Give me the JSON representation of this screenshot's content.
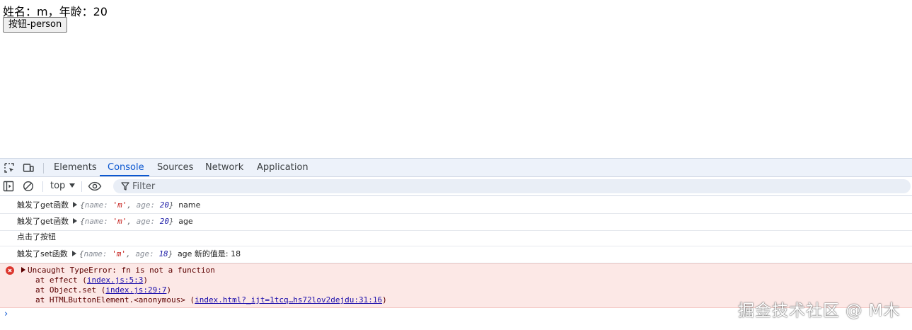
{
  "page": {
    "info_text": "姓名：m，年龄：20",
    "button_label": "按钮-person"
  },
  "devtools": {
    "tabs": [
      "Elements",
      "Console",
      "Sources",
      "Network",
      "Application"
    ],
    "active_tab": "Console",
    "context": "top",
    "filter_placeholder": "Filter",
    "colors": {
      "accent": "#0b57d0",
      "error_bg": "#fce8e6",
      "error_icon": "#dc362e"
    }
  },
  "console": {
    "rows": [
      {
        "prefix": "触发了get函数",
        "obj_name_key": "name:",
        "obj_name_val": "'m'",
        "obj_age_key": "age:",
        "obj_age_val": "20",
        "suffix": "name"
      },
      {
        "prefix": "触发了get函数",
        "obj_name_key": "name:",
        "obj_name_val": "'m'",
        "obj_age_key": "age:",
        "obj_age_val": "20",
        "suffix": "age"
      },
      {
        "prefix": "点击了按钮"
      },
      {
        "prefix": "触发了set函数",
        "obj_name_key": "name:",
        "obj_name_val": "'m'",
        "obj_age_key": "age:",
        "obj_age_val": "18",
        "suffix": "age 新的值是: 18"
      }
    ],
    "error": {
      "message": "Uncaught TypeError: fn is not a function",
      "stack": [
        {
          "at": "at effect (",
          "link": "index.js:5:3",
          "end": ")"
        },
        {
          "at": "at Object.set (",
          "link": "index.js:29:7",
          "end": ")"
        },
        {
          "at": "at HTMLButtonElement.<anonymous> (",
          "link": "index.html?_ijt=1tcq…hs72lov2dejdu:31:16",
          "end": ")"
        }
      ]
    },
    "prompt_symbol": "›"
  },
  "watermark": "掘金技术社区 @ M木"
}
